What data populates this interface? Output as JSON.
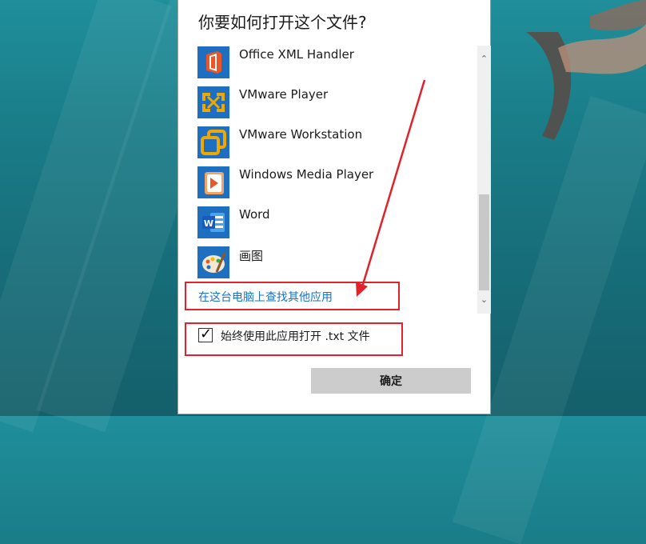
{
  "dialog": {
    "title": "你要如何打开这个文件?",
    "apps": [
      {
        "label": "Office XML Handler",
        "icon": "office-xml-icon"
      },
      {
        "label": "VMware Player",
        "icon": "vmware-player-icon"
      },
      {
        "label": "VMware Workstation",
        "icon": "vmware-workstation-icon"
      },
      {
        "label": "Windows Media Player",
        "icon": "windows-media-player-icon"
      },
      {
        "label": "Word",
        "icon": "word-icon"
      },
      {
        "label": "画图",
        "icon": "paint-icon"
      }
    ],
    "more_apps_link": "在这台电脑上查找其他应用",
    "always_use": {
      "label": "始终使用此应用打开 .txt 文件",
      "checked": true
    },
    "ok_label": "确定"
  },
  "colors": {
    "accent_link": "#1a73c8",
    "annotation_red": "#e0222a",
    "icon_blue": "#1e6fc0"
  }
}
